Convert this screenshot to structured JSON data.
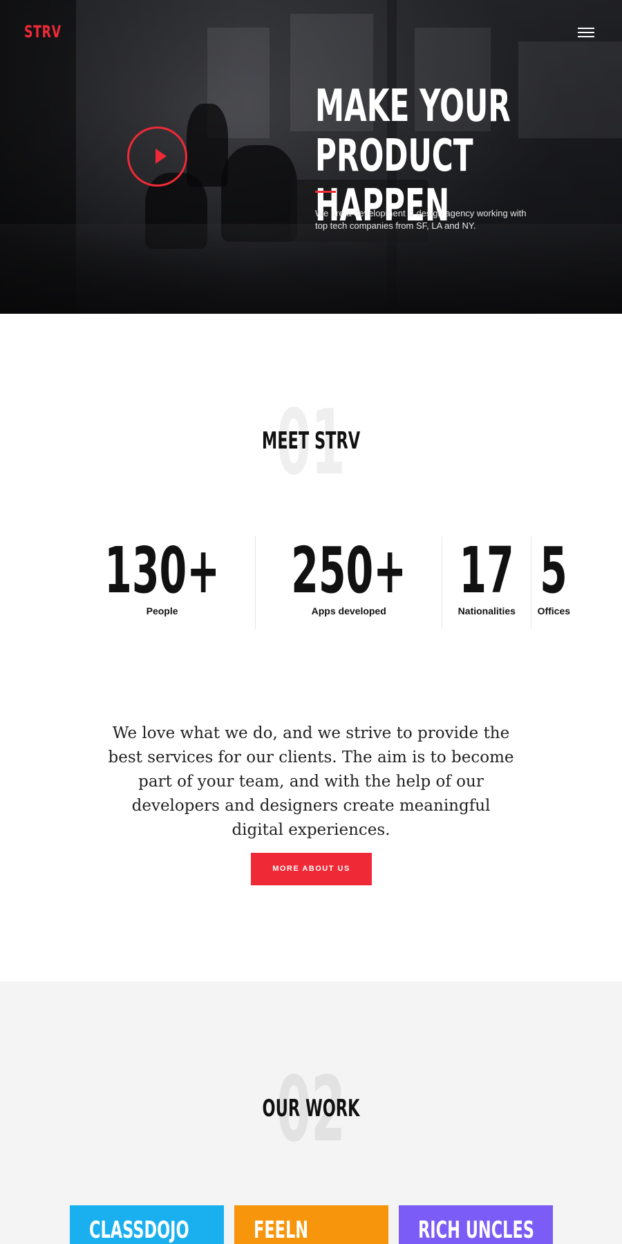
{
  "brand": {
    "logo": "STRV",
    "accent": "#ef2a36"
  },
  "nav": {
    "menu_icon": "hamburger-menu-icon"
  },
  "hero": {
    "title": "MAKE YOUR\nPRODUCT HAPPEN",
    "subtitle": "We are a development & design agency working with top tech companies from SF, LA and NY.",
    "play_icon": "play-icon"
  },
  "meet": {
    "number": "01",
    "title": "MEET STRV",
    "stats": [
      {
        "value": "130+",
        "label": "People"
      },
      {
        "value": "250+",
        "label": "Apps developed"
      },
      {
        "value": "17",
        "label": "Nationalities"
      },
      {
        "value": "5",
        "label": "Offices"
      }
    ],
    "quote": "We love what we do, and we strive to provide the best services for our clients. The aim is to become part of your team, and with the help of our developers and designers create meaningful digital experiences.",
    "cta": "MORE ABOUT US"
  },
  "work": {
    "number": "02",
    "title": "OUR WORK",
    "cards": [
      {
        "name": "CLASSDOJO",
        "color": "#1ab0f0"
      },
      {
        "name": "FEELN",
        "color": "#f7960c"
      },
      {
        "name": "RICH UNCLES",
        "color": "#7b5cf6"
      }
    ]
  }
}
